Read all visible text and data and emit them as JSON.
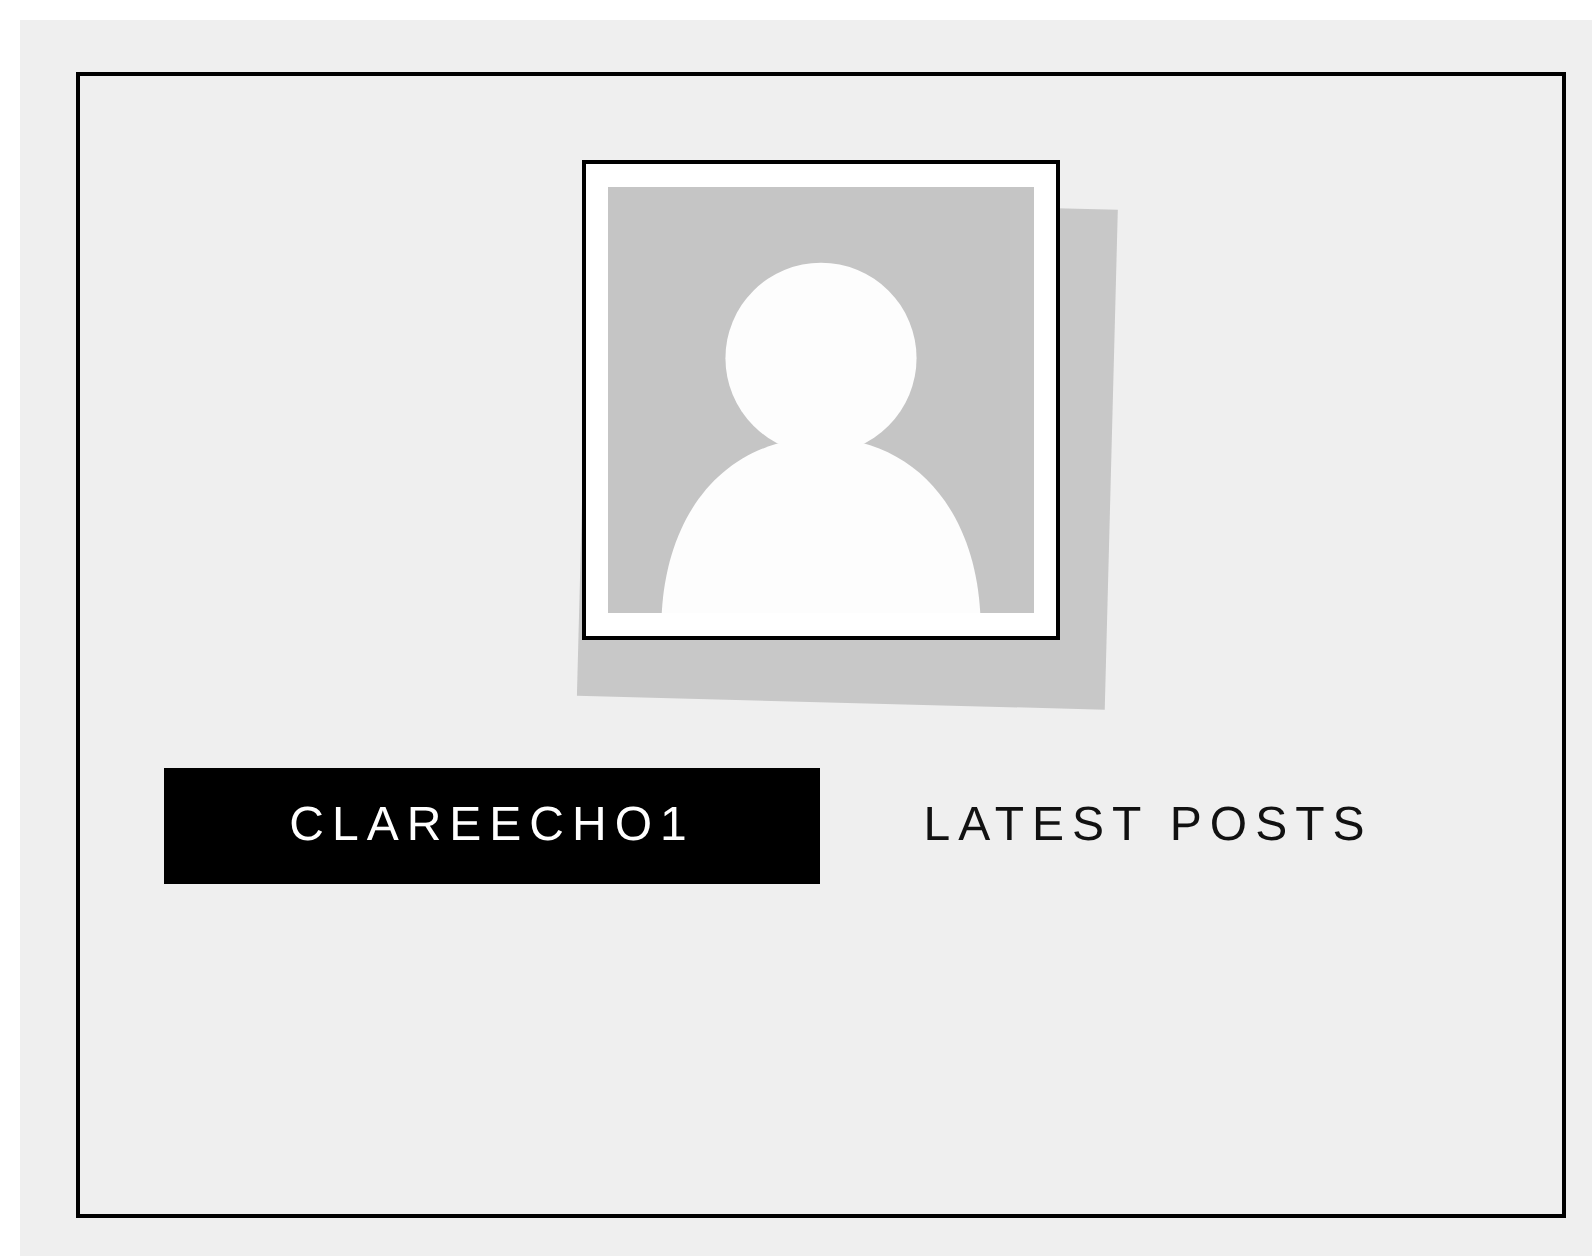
{
  "profile": {
    "avatar": {
      "kind": "default-silhouette"
    }
  },
  "tabs": [
    {
      "label": "CLAREECHO1",
      "selected": true
    },
    {
      "label": "LATEST POSTS",
      "selected": false
    }
  ]
}
